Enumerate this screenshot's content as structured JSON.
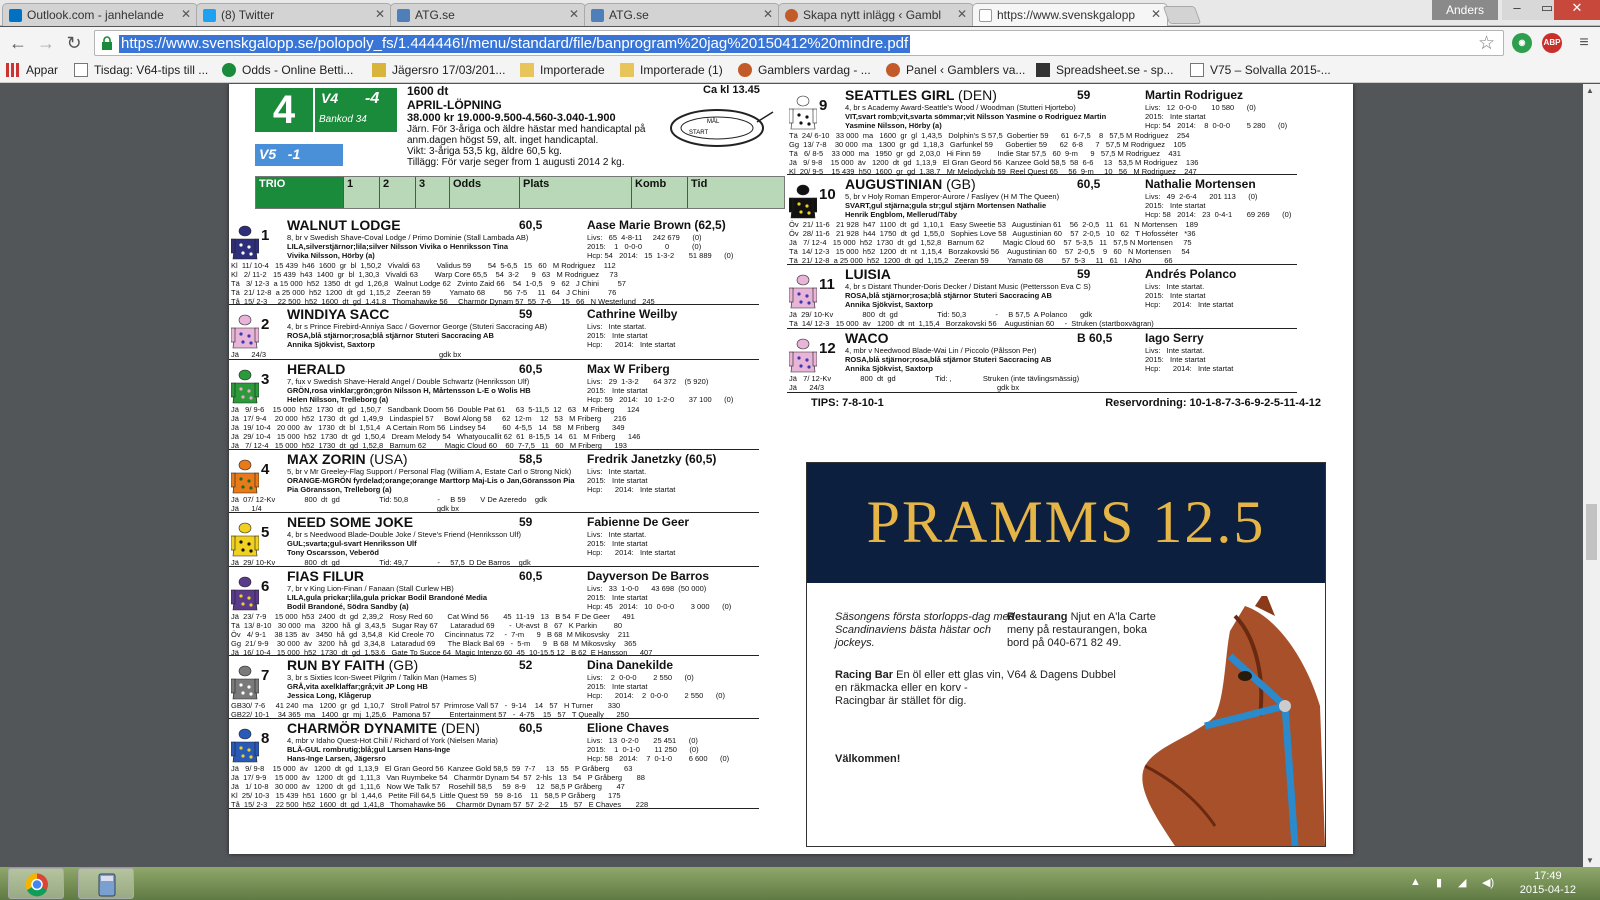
{
  "browser": {
    "tabs": [
      {
        "label": "Outlook.com - janhelande",
        "color": "#0072c6"
      },
      {
        "label": "(8) Twitter",
        "color": "#1da1f2"
      },
      {
        "label": "ATG.se",
        "color": "#4f7fb8"
      },
      {
        "label": "ATG.se",
        "color": "#4f7fb8"
      },
      {
        "label": "Skapa nytt inlägg ‹ Gambl",
        "color": "#c35a2a"
      },
      {
        "label": "https://www.svenskgalopp",
        "color": "#1a8a3b"
      }
    ],
    "user": "Anders",
    "url": "https://www.svenskgalopp.se/polopoly_fs/1.444446!/menu/standard/file/banprogram%20jag%20150412%20mindre.pdf",
    "bookmarks": [
      "Appar",
      "Tisdag: V64-tips till ...",
      "Odds - Online Betti...",
      "Jägersro 17/03/201...",
      "Importerade",
      "Importerade (1)",
      "Gamblers vardag - ...",
      "Panel ‹ Gamblers va...",
      "Spreadsheet.se - sp...",
      "V75 – Solvalla 2015-..."
    ]
  },
  "race": {
    "number": "4",
    "v4": "V4",
    "v4_leg": "-4",
    "bankod": "Bankod 34",
    "v5": "V5",
    "v5_leg": "-1",
    "distance": "1600 dt",
    "title": "APRIL-LÖPNING",
    "prize": "38.000 kr   19.000-9.500-4.560-3.040-1.900",
    "conditions": "Järn. För 3-åriga och äldre hästar med handicaptal på anm.dagen högst 59, alt. inget handicaptal.",
    "weights": "Vikt:  3-åriga 53,5 kg, äldre 60,5 kg.",
    "addition": "Tillägg:  För varje seger from 1 augusti 2014 2 kg.",
    "time": "Ca kl 13.45",
    "track_mal": "MÅL",
    "track_start": "START",
    "trio_cols": [
      "TRIO",
      "1",
      "2",
      "3",
      "Odds",
      "Plats",
      "Komb",
      "Tid"
    ]
  },
  "horses_left": [
    {
      "num": "1",
      "name": "WALNUT LODGE",
      "weight": "60,5",
      "rider": "Aase Marie Brown (62,5)",
      "info": [
        "8, br v Swedish Shave-Coval Lodge / Primo Dominie (Stall Lambada AB)",
        "LILA,silverstjärnor;lila;silver Nilsson Vivika o Henriksson Tina",
        "Vivika Nilsson, Hörby (a)"
      ],
      "stats": "Livs:   65  4-8-11     242 679      (0)\n2015:    1   0-0-0           0           (0)\nHcp: 54   2014:   15  1-3-2       51 889      (0)",
      "form": [
        "Kl  11/ 10-4   15 439  h46  1600  gr  bl  1,50,2   Vivaldi 63        Validus 59        54  5-6,5   15   60   M Rodriguez    112",
        "Kl   2/ 11-2   15 439  h43  1400  gr  bl  1,30,3   Vivaldi 63        Warp Core 65,5    54  3-2      9   63   M Rodriguez     73",
        "Tä   3/ 12-3  a 15 000  h52  1350  dt  gd  1,26,8   Walnut Lodge 62   Zvinto Zaid 66    54  1-0,5    9   62   J Chini         57",
        "Tä  21/ 12-8  a 25 000  h52  1200  dt  gd  1,15,2   Zeeran 59         Yamato 68         56  7-5     11   64   J Chini         76",
        "Tå  15/ 2-3     22 500  h52  1600  dt  gd  1,41,8   Thomahawke 56     Charmör Dynam 57  55  7-6     15   66   N Westerlund   245"
      ],
      "silk": [
        "#2e2e7a",
        "#ffffff"
      ]
    },
    {
      "num": "2",
      "name": "WINDIYA SACC",
      "weight": "59",
      "rider": "Cathrine Weilby",
      "info": [
        "4, br s Prince Firebird-Anniya Sacc / Governor George (Stuteri Saccracing AB)",
        "ROSA,blå stjärnor;rosa;blå stjärnor Stuteri Saccracing AB",
        "Annika Sjökvist, Saxtorp"
      ],
      "stats": "Livs:   Inte startat.\n2015:   Inte startat\nHcp:      2014:   Inte startat",
      "form": [
        "Jä      24/3                                                                                   gdk bx"
      ],
      "silk": [
        "#e8b4d8",
        "#3a3ab0"
      ]
    },
    {
      "num": "3",
      "name": "HERALD",
      "weight": "60,5",
      "rider": "Max W Friberg",
      "info": [
        "7, fux v Swedish Shave-Herald Angel / Double Schwartz (Henriksson Ulf)",
        "GRÖN,rosa vinklar;grön;grön Nilsson H, Mårtensson L-E o Wolis HB",
        "Helen Nilsson, Trelleborg (a)"
      ],
      "stats": "Livs:   29  1-3-2       64 372    (5 920)\n2015:   Inte startat\nHcp: 59   2014:   10  1-2-0       37 100      (0)",
      "form": [
        "Jä   9/ 9-6    15 000  h52  1730  dt  gd  1,50,7   Sandbank Doom 56  Double Pat 61     63  5-11,5  12   63   M Friberg      124",
        "Jä  17/ 9-4    20 000  h52  1730  dt  gd  1,49,9   Lindaspiel 57     Bowl Along 58     62  12-m    12   53   M Friberg      216",
        "Jä  19/ 10-4   20 000  äv   1730  dt  bl  1,51,4   A Certain Rom 56  Lindsey 54        60  4-5,5   14   58   M Friberg      349",
        "Jä  29/ 10-4   15 000  h52  1730  dt  gd  1,50,4   Dream Melody 54   Whatyoucallit 62  61  8-15,5  14   61   M Friberg      146",
        "Jä   7/ 12-4   15 000  h52  1730  dt  gd  1,52,8   Barnum 62         Magic Cloud 60    60  7-7,5   11   60   M Friberg      193"
      ],
      "silk": [
        "#2a9a3a",
        "#f0a8c8"
      ]
    },
    {
      "num": "4",
      "name": "MAX ZORIN",
      "country": "(USA)",
      "weight": "58,5",
      "rider": "Fredrik Janetzky (60,5)",
      "info": [
        "5, br v Mr Greeley-Flag Support / Personal Flag (William A, Estate Carl o Strong Nick)",
        "ORANGE-MGRÖN fyrdelad;orange;orange Marttorp Maj-Lis o Jan,Göransson Pia",
        "Pia Göransson, Trelleborg (a)"
      ],
      "stats": "Livs:   Inte startat.\n2015:   Inte startat\nHcp:      2014:   Inte startat",
      "form": [
        "Jä  07/ 12-Kv              800  dt  gd                   Tid: 50,8              -     B 59       V De Azeredo    gdk",
        "Jä      1/4                                                                                    gdk bx"
      ],
      "silk": [
        "#e87a1a",
        "#1a6a2a"
      ]
    },
    {
      "num": "5",
      "name": "NEED SOME JOKE",
      "weight": "59",
      "rider": "Fabienne De Geer",
      "info": [
        "4, br s Needwood Blade-Double Joke / Steve's Friend (Henriksson Ulf)",
        "GUL;svarta;gul-svart Henriksson Ulf",
        "Tony Oscarsson, Veberöd"
      ],
      "stats": "Livs:   Inte startat.\n2015:   Inte startat\nHcp:      2014:   Inte startat",
      "form": [
        "Jä  29/ 10-Kv              800  dt  gd                   Tid: 49,7              -     57,5  D De Barros    gdk"
      ],
      "silk": [
        "#f0d020",
        "#111111"
      ]
    },
    {
      "num": "6",
      "name": "FIAS FILUR",
      "weight": "60,5",
      "rider": "Dayverson De Barros",
      "info": [
        "7, br v King Lion-Finan / Fanaan (Stall Curlew HB)",
        "LILA,gula prickar;lila,gula prickar Bodil Brandoné Media",
        "Bodil Brandoné, Södra Sandby (a)"
      ],
      "stats": "Livs:   33  1-0-0      43 698  (50 000)\n2015:   Inte startat\nHcp: 45   2014:   10  0-0-0        3 000      (0)",
      "form": [
        "Jä  23/ 7-9    15 000  h53  2400  dt  gd  2,39,2   Rosy Red 60       Cat Wind 56       45  11-19   13   B 54  F De Geer      491",
        "Tä  13/ 8-10   30 000  ma   3200  hå  gl  3,43,5   Sugar Ray 67      Lataradud 69       -  Ut-avst  8   67   K Parkin        80",
        "Öv   4/ 9-1    38 135  äv   3450  hå  gd  3,54,8   Kid Creole 70     Cincinnatus 72     -  7-m      9   B 68  M Mikosvsky    211",
        "Gg  21/ 9-9    30 000  äv   3200  hå  gd  3,34,8   Lataradud 69      The Black Bal 69   -  5-m      9   B 68  M Mikosvsky    365",
        "Jä  16/ 10-4   15 000  h52  1730  dt  gd  1,53,6   Gate To Succe 64  Magic Intenzo 60  45  10-15,5 12   B 62  E Hansson      407"
      ],
      "silk": [
        "#5a3a8a",
        "#f0d020"
      ]
    },
    {
      "num": "7",
      "name": "RUN BY FAITH",
      "country": "(GB)",
      "weight": "52",
      "rider": "Dina Danekilde",
      "info": [
        "3, br s Sixties Icon-Sweet Pilgrim / Talkin Man (Hames S)",
        "GRÅ,vita axelklaffar;grå;vit JP Long HB",
        "Jessica Long, Klågerup"
      ],
      "stats": "Livs:    2  0-0-0        2 550      (0)\n2015:   Inte startat\nHcp:      2014:    2  0-0-0        2 550      (0)",
      "form": [
        "GB30/ 7-6     41 240  ma   1200  gr  gd  1,10,7   Stroll Patrol 57  Primrose Vall 57   -  9-14    14   57   H Turner       330",
        "GB22/ 10-1    34 365  ma   1400  gr  mj  1,25,6   Pamona 57         Entertainment 57   -  4-75    15   57   T Queally      250"
      ],
      "silk": [
        "#7a7a7a",
        "#ffffff"
      ]
    },
    {
      "num": "8",
      "name": "CHARMÖR DYNAMITE",
      "country": "(DEN)",
      "weight": "60,5",
      "rider": "Elione Chaves",
      "info": [
        "4, mbr v Idaho Quest-Hot Chili / Richard of York (Nielsen Maria)",
        "BLÅ-GUL rombrutig;blå;gul Larsen Hans-Inge",
        "Hans-Inge Larsen, Jägersro"
      ],
      "stats": "Livs:   13  0-2-0       25 451      (0)\n2015:    1  0-1-0       11 250      (0)\nHcp: 58   2014:    7  0-1-0        6 600      (0)",
      "form": [
        "Jä   9/ 9-8    15 000  äv   1200  dt  gd  1,13,9   El Gran Geord 56  Kanzee Gold 58,5  59  7-7     13   55   P Gråberg       63",
        "Jä  17/ 9-9    15 000  äv   1200  dt  gd  1,11,3   Van Ruymbeke 54   Charmör Dynam 54  57  2-hls   13   54   P Gråberg       88",
        "Jä   1/ 10-8   30 000  äv   1200  dt  gd  1,11,6   Now We Talk 57    Rosehill 58,5     59  8-9     12   58,5 P Gråberg       47",
        "Kl  25/ 10-3   15 439  h51  1600  gr  bl  1,44,6   Petite Fill 64,5  Little Quest 59   59  8-16    11   58,5 P Gråberg      175",
        "Tå  15/ 2-3    22 500  h52  1600  dt  gd  1,41,8   Thomahawke 56     Charmör Dynam 57  57  2-2     15   57   E Chaves       228"
      ],
      "silk": [
        "#2a5ab8",
        "#f0d020"
      ]
    }
  ],
  "horses_right": [
    {
      "num": "9",
      "name": "SEATTLES GIRL",
      "country": "(DEN)",
      "weight": "59",
      "rider": "Martin Rodriguez",
      "info": [
        "4, br s Academy Award-Seattle's Wood / Woodman (Stutteri Hjortebo)",
        "VIT,svart romb;vit,svarta sömmar;vit Nilsson Yasmine o Rodriguez Martin",
        "Yasmine Nilsson, Hörby (a)"
      ],
      "stats": "Livs:   12  0-0-0       10 580      (0)\n2015:   Inte startat\nHcp: 54   2014:    8  0-0-0        5 280      (0)",
      "form": [
        "Tä  24/ 6-10   33 000  ma   1600  gr  gl  1,43,5   Dolphin's S 57,5  Gobertier 59      61  6-7,5    8   57,5 M Rodriguez    254",
        "Gg  13/ 7-8    30 000  ma   1300  gr  gd  1,18,3   Garfunkel 59      Gobertier 59      62  6-8      7   57,5 M Rodriguez    105",
        "Tä   6/ 8-5    33 000  ma   1950  gr  gd  2,03,0   Hi Finn 59        Indie Star 57,5   60  9-m      9   57,5 M Rodriguez    431",
        "Jä   9/ 9-8    15 000  äv   1200  dt  gd  1,13,9   El Gran Geord 56  Kanzee Gold 58,5  58  6-6     13   53,5 M Rodriguez    136",
        "Kl  20/ 9-5    15 439  h50  1600  gr  gd  1,38,7   Mr Melodyclub 59  Reel Quest 65     56  9-m     10   56   M Rodriguez    247"
      ],
      "silk": [
        "#ffffff",
        "#111111"
      ]
    },
    {
      "num": "10",
      "name": "AUGUSTINIAN",
      "country": "(GB)",
      "weight": "60,5",
      "rider": "Nathalie Mortensen",
      "info": [
        "5, br v Holy Roman Emperor-Aurore / Fasliyev (H M The Queen)",
        "SVART,gul stjärna;gula str;gul stjärn Mortensen Nathalie",
        "Henrik Engblom, Mellerud/Täby"
      ],
      "stats": "Livs:   49  2-6-4      201 113      (0)\n2015:   Inte startat\nHcp: 58   2014:   23  0-4-1       69 269      (0)",
      "form": [
        "Öv  21/ 11-6   21 928  h47  1100  dt  gd  1,10,1   Easy Sweetie 53   Augustinian 61    56  2-0,5   11   61   N Mortensen    189",
        "Öv  28/ 11-6   21 928  h44  1750  dt  gd  1,55,0   Sophies Love 58   Augustinian 60    57  2-0,5   10   62   T Hofosséter   *36",
        "Jä   7/ 12-4   15 000  h52  1730  dt  gd  1,52,8   Barnum 62         Magic Cloud 60    57  5-3,5   11   57,5 N Mortensen     75",
        "Tä  14/ 12-3   15 000  h52  1200  dt  nt  1,15,4   Borzakovski 56    Augustinian 60    57  2-0,5    9   60   N Mortensen     54",
        "Tä  21/ 12-8  a 25 000  h52  1200  dt  gd  1,15,2   Zeeran 59         Yamato 68         57  5-3     11   61   I Aho           66"
      ],
      "silk": [
        "#111111",
        "#f0d020"
      ]
    },
    {
      "num": "11",
      "name": "LUISIA",
      "weight": "59",
      "rider": "Andrés Polanco",
      "info": [
        "4, br s Distant Thunder-Doris Decker / Distant Music (Pettersson Eva C S)",
        "ROSA,blå stjärnor;rosa;blå stjärnor Stuteri Saccracing AB",
        "Annika Sjökvist, Saxtorp"
      ],
      "stats": "Livs:   Inte startat.\n2015:   Inte startat\nHcp:      2014:   Inte startat",
      "form": [
        "Jä  29/ 10-Kv              800  dt  gd                   Tid: 50,3              -     B 57,5  A Polanco      gdk",
        "Tä  14/ 12-3   15 000  äv   1200  dt  nt  1,15,4   Borzakovski 56    Augustinian 60     -  Struken (startboxvägran)"
      ],
      "silk": [
        "#e8b4d8",
        "#3a3ab0"
      ]
    },
    {
      "num": "12",
      "name": "WACO",
      "weight": "B 60,5",
      "rider": "Iago Serry",
      "info": [
        "4, mbr v Needwood Blade-Wai Lin / Piccolo (Pålsson Per)",
        "ROSA,blå stjärnor;rosa,blå stjärnor Stuteri Saccracing AB",
        "Annika Sjökvist, Saxtorp"
      ],
      "stats": "Livs:   Inte startat.\n2015:   Inte startat\nHcp:      2014:   Inte startat",
      "form": [
        "Jä   7/ 12-Kv              800  dt  gd                   Tid: ,               Struken (inte tävlingsmässig)",
        "Jä      24/3                                                                                   gdk bx"
      ],
      "silk": [
        "#e8b4d8",
        "#3a3ab0"
      ]
    }
  ],
  "tips": "TIPS: 7-8-10-1",
  "reservordning": "Reservordning: 10-1-8-7-3-6-9-2-5-11-4-12",
  "ad": {
    "title": "PRAMMS 12.5",
    "intro": "Säsongens första storlopps-dag med Scandinaviens bästa hästar och jockeys.",
    "racingbar_head": "Racing Bar",
    "racingbar_text": "En öl eller ett glas vin, en räkmacka eller en korv - Racingbar är stället för dig.",
    "welcome": "Välkommen!",
    "restaurant_head": "Restaurang",
    "restaurant_text": "Njut en A'la Carte meny på restaurangen, boka bord på 040-671 82 49.",
    "v64": "V64 & Dagens Dubbel"
  },
  "taskbar": {
    "time": "17:49",
    "date": "2015-04-12"
  }
}
